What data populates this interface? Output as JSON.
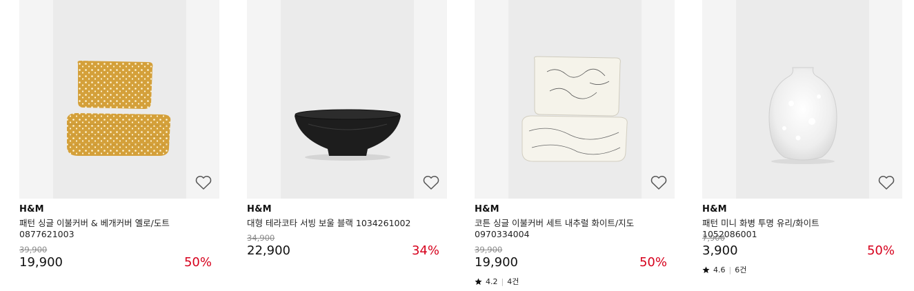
{
  "products": [
    {
      "brand": "H&M",
      "title": "패턴 싱글 이불커버 & 베개커버 옐로/도트 0877621003",
      "old_price": "39,900",
      "price": "19,900",
      "discount": "50%",
      "rating": "",
      "reviews": "",
      "image_icon": "yellow-dot-bedding-image"
    },
    {
      "brand": "H&M",
      "title": "대형 테라코타 서빙 보울 블랙 1034261002",
      "old_price": "34,900",
      "price": "22,900",
      "discount": "34%",
      "rating": "",
      "reviews": "",
      "image_icon": "black-bowl-image"
    },
    {
      "brand": "H&M",
      "title": "코튼 싱글 이불커버 세트 내추럴 화이트/지도 0970334004",
      "old_price": "39,900",
      "price": "19,900",
      "discount": "50%",
      "rating": "4.2",
      "reviews": "4건",
      "image_icon": "map-print-bedding-image"
    },
    {
      "brand": "H&M",
      "title": "패턴 미니 화병 투명 유리/화이트 1052086001",
      "old_price": "7,900",
      "price": "3,900",
      "discount": "50%",
      "rating": "4.6",
      "reviews": "6건",
      "image_icon": "glass-vase-image"
    }
  ],
  "colors": {
    "discount": "#d6001c",
    "image_bg": "#f4f4f4",
    "old_price": "#8a8a8a"
  },
  "icons": {
    "favorite": "heart-outline-icon",
    "rating": "star-icon"
  }
}
